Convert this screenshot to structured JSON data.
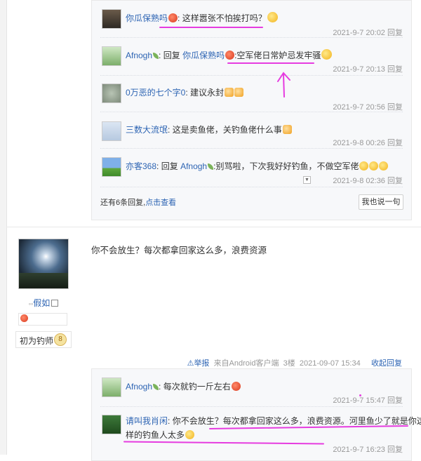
{
  "thread1": {
    "replies": [
      {
        "name": "你瓜保熟吗",
        "body": "这样嚣张不怕挨打吗？",
        "time": "2021-9-7 20:02",
        "action": "回复"
      },
      {
        "name": "Afnogh",
        "prefix": "回复",
        "target": "你瓜保熟吗",
        "body": ":空军佬日常妒忌发牢骚",
        "time": "2021-9-7 20:13",
        "action": "回复"
      },
      {
        "name": "0万恶的七个字0",
        "body": "建议永封",
        "time": "2021-9-7 20:56",
        "action": "回复"
      },
      {
        "name": "三数大流氓",
        "body": "这是卖鱼佬，关钓鱼佬什么事",
        "time": "2021-9-8 00:26",
        "action": "回复"
      },
      {
        "name": "亦客368",
        "prefix": "回复",
        "target": "Afnogh",
        "body": ":别骂啦，下次我好好钓鱼，不做空军佬",
        "time": "2021-9-8 02:36",
        "action": "回复"
      }
    ],
    "more_text": "还有6条回复,",
    "more_link": "点击查看",
    "reply_button": "我也说一句"
  },
  "post2": {
    "username": "假如",
    "level_title": "初为钓师",
    "level_num": "8",
    "content": "你不会放生？每次都拿回家这么多，浪费资源",
    "report": "举报",
    "source": "来自Android客户端",
    "floor": "3楼",
    "date": "2021-09-07 15:34",
    "collapse": "收起回复",
    "replies": [
      {
        "name": "Afnogh",
        "body": "每次就钓一斤左右",
        "time": "2021-9-7 15:47",
        "action": "回复"
      },
      {
        "name": "请叫我肖闲",
        "body_line1": "你不会放生？每次都拿回家这么多，浪费资源。河里鱼少了就是你这",
        "body_line2": "样的钓鱼人太多",
        "time": "2021-9-7 16:23",
        "action": "回复"
      }
    ]
  },
  "colors": {
    "link": "#2d64b3",
    "annotation": "#e63ce0"
  }
}
